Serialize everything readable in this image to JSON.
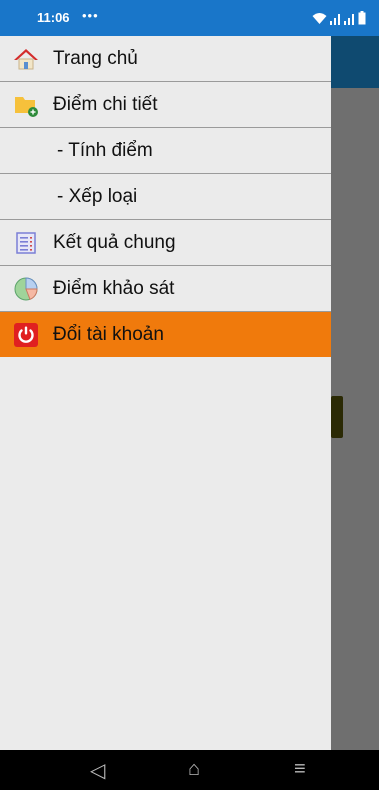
{
  "status_bar": {
    "time": "11:06",
    "more_dots": "•••",
    "icons": [
      "wifi-icon",
      "signal-icon",
      "signal-icon",
      "battery-icon"
    ],
    "color": "#1976c9"
  },
  "drawer": {
    "items": [
      {
        "label": "Trang chủ",
        "icon": "home-icon",
        "active": false
      },
      {
        "label": "Điểm chi tiết",
        "icon": "folder-add-icon",
        "active": false
      },
      {
        "label": "- Tính điểm",
        "icon": "",
        "active": false
      },
      {
        "label": "- Xếp loại",
        "icon": "",
        "active": false
      },
      {
        "label": "Kết quả chung",
        "icon": "list-icon",
        "active": false
      },
      {
        "label": "Điểm khảo sát",
        "icon": "pie-chart-icon",
        "active": false
      },
      {
        "label": "Đổi tài khoản",
        "icon": "power-icon",
        "active": true
      }
    ],
    "active_color": "#f07a0c"
  },
  "nav_bar": {
    "back": "◁",
    "home": "⌂",
    "menu": "≡"
  }
}
